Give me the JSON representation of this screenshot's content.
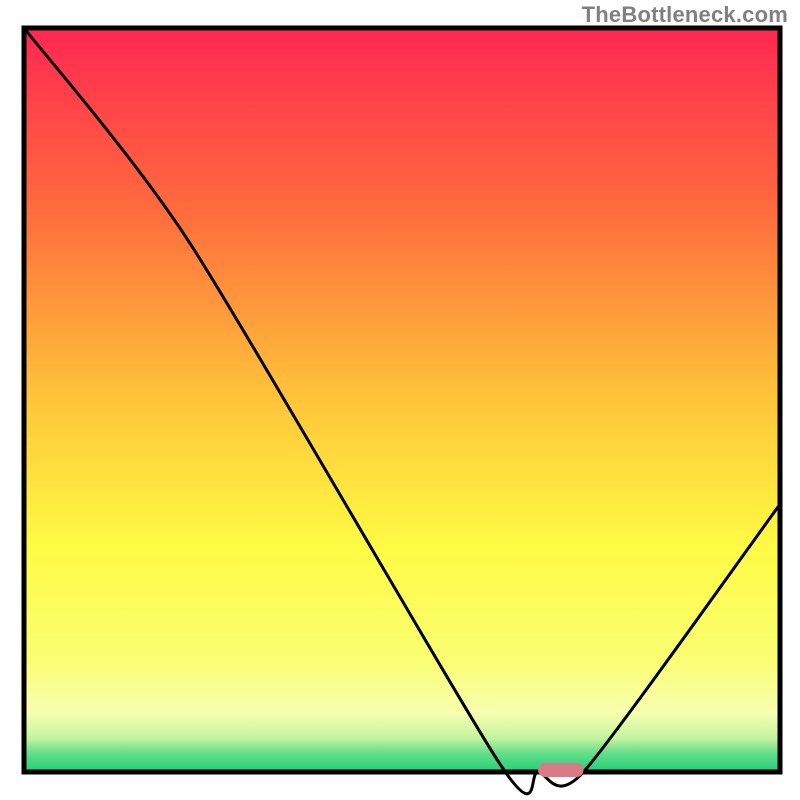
{
  "attribution": "TheBottleneck.com",
  "colors": {
    "frame": "#000000",
    "curve": "#000000",
    "marker_fill": "#d97b86",
    "gradient_stops": [
      {
        "offset": 0.0,
        "color": "#ff2752"
      },
      {
        "offset": 0.25,
        "color": "#ff6d3d"
      },
      {
        "offset": 0.5,
        "color": "#ffc53a"
      },
      {
        "offset": 0.7,
        "color": "#fffb44"
      },
      {
        "offset": 0.85,
        "color": "#fafe72"
      },
      {
        "offset": 0.92,
        "color": "#f8ffb0"
      },
      {
        "offset": 0.955,
        "color": "#c3f3a0"
      },
      {
        "offset": 0.975,
        "color": "#62dd8b"
      },
      {
        "offset": 1.0,
        "color": "#1fd074"
      }
    ]
  },
  "chart_data": {
    "type": "line",
    "title": "",
    "xlabel": "",
    "ylabel": "",
    "xlim": [
      0,
      100
    ],
    "ylim": [
      0,
      100
    ],
    "categories": [
      0,
      22,
      63,
      68,
      74,
      100
    ],
    "values": [
      100,
      71,
      1,
      0,
      0,
      36
    ],
    "marker": {
      "x_range": [
        68,
        74
      ],
      "y": 0
    },
    "notes": "Single black curve over vertical heat gradient; red pill marks minimum near x≈70."
  }
}
